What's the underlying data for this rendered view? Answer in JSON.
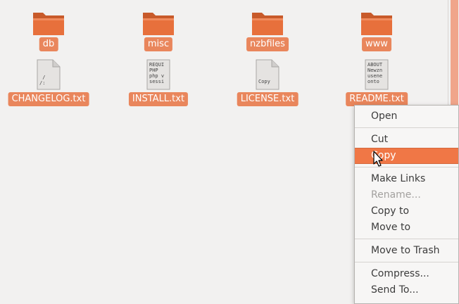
{
  "files": [
    {
      "name": "db",
      "kind": "folder"
    },
    {
      "name": "misc",
      "kind": "folder"
    },
    {
      "name": "nzbfiles",
      "kind": "folder"
    },
    {
      "name": "www",
      "kind": "folder"
    },
    {
      "name": "CHANGELOG.txt",
      "kind": "text",
      "preview": " /\n/:"
    },
    {
      "name": "INSTALL.txt",
      "kind": "text",
      "preview": "REQUI\nPHP\nphp v\nsessi"
    },
    {
      "name": "LICENSE.txt",
      "kind": "text",
      "preview": "\n\n\nCopy"
    },
    {
      "name": "README.txt",
      "kind": "text",
      "preview": "ABOUT\nNewzn\nusene\nonto"
    }
  ],
  "context_menu": {
    "open": "Open",
    "cut": "Cut",
    "copy": "Copy",
    "make_links": "Make Links",
    "rename": "Rename...",
    "copy_to": "Copy to",
    "move_to": "Move to",
    "move_to_trash": "Move to Trash",
    "compress": "Compress...",
    "send_to": "Send To..."
  },
  "colors": {
    "selection": "#e9865c",
    "menu_highlight": "#f07746",
    "folder": "#e06b38",
    "background": "#f2f1f0"
  }
}
